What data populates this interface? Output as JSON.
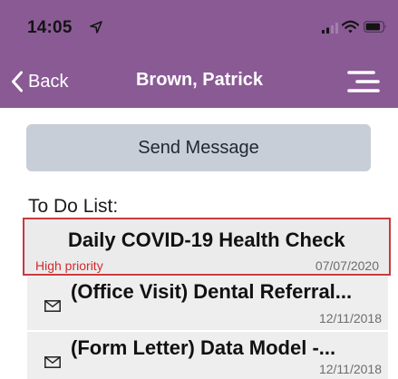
{
  "status_bar": {
    "time": "14:05",
    "icons": [
      "location-arrow-icon",
      "cellular-signal-icon",
      "wifi-icon",
      "battery-icon"
    ]
  },
  "nav": {
    "back_label": "Back",
    "title": "Brown, Patrick",
    "menu_icon": "hamburger-menu-icon"
  },
  "actions": {
    "send_message_label": "Send Message"
  },
  "todo": {
    "label": "To Do List:",
    "items": [
      {
        "title": "Daily COVID-19 Health Check",
        "priority": "High priority",
        "date": "07/07/2020",
        "icon": "",
        "selected": true
      },
      {
        "title": "(Office Visit) Dental Referral...",
        "date": "12/11/2018",
        "icon": "envelope-icon"
      },
      {
        "title": "(Form Letter) Data Model -...",
        "date": "12/11/2018",
        "icon": "envelope-icon"
      }
    ]
  },
  "colors": {
    "header_bg": "#8a5a95",
    "send_button_bg": "#c7ced7",
    "list_item_bg": "#eeeeef",
    "selected_border": "#c83a3e",
    "priority_text": "#d52a2a"
  }
}
